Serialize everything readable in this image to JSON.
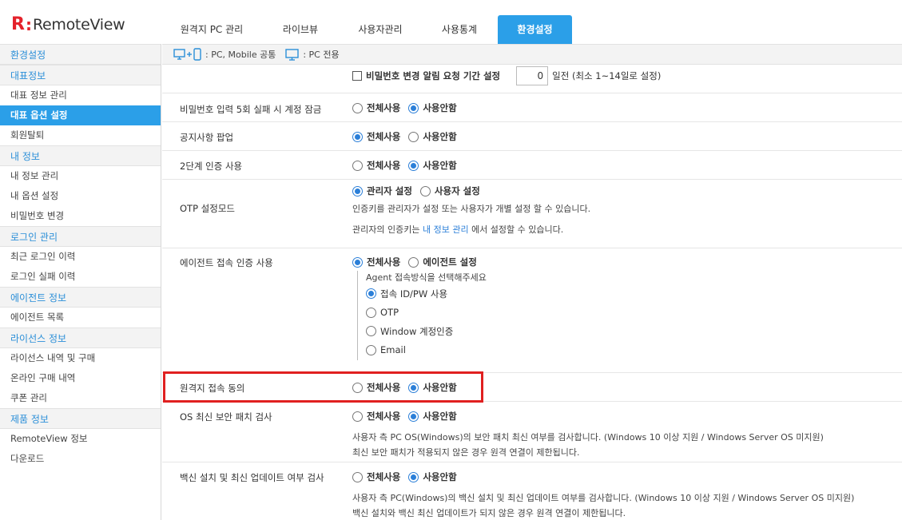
{
  "brand": {
    "mark": "R",
    "colon": ":",
    "name": "RemoteView"
  },
  "nav": [
    {
      "label": "원격지 PC 관리",
      "width": 124
    },
    {
      "label": "라이브뷰",
      "width": 98
    },
    {
      "label": "사용자관리",
      "width": 102
    },
    {
      "label": "사용통계",
      "width": 96
    },
    {
      "label": "환경설정",
      "width": 93
    }
  ],
  "sidebar": {
    "title": "환경설정",
    "sections": [
      {
        "head": "대표정보",
        "items": [
          "대표 정보 관리",
          "대표 옵션 설정",
          "회원탈퇴"
        ]
      },
      {
        "head": "내 정보",
        "items": [
          "내 정보 관리",
          "내 옵션 설정",
          "비밀번호 변경"
        ]
      },
      {
        "head": "로그인 관리",
        "items": [
          "최근 로그인 이력",
          "로그인 실패 이력"
        ]
      },
      {
        "head": "에이전트 정보",
        "items": [
          "에이전트 목록"
        ]
      },
      {
        "head": "라이선스 정보",
        "items": [
          "라이선스 내역 및 구매",
          "온라인 구매 내역",
          "쿠폰 관리"
        ]
      },
      {
        "head": "제품 정보",
        "items": [
          "RemoteView 정보",
          "다운로드"
        ]
      }
    ]
  },
  "legend": {
    "common": ": PC, Mobile 공통",
    "pc": ": PC 전용"
  },
  "settings": {
    "pw_notice": {
      "label": "비밀번호 변경 알림 요청 기간 설정",
      "value": "0",
      "suffix": "일전 (최소 1~14일로 설정)"
    },
    "opt_all": "전체사용",
    "opt_none": "사용안함",
    "lock": {
      "label": "비밀번호 입력 5회 실패 시 계정 잠금"
    },
    "popup": {
      "label": "공지사항 팝업"
    },
    "twofa": {
      "label": "2단계 인증 사용"
    },
    "otp": {
      "label": "OTP 설정모드",
      "opt_admin": "관리자 설정",
      "opt_user": "사용자 설정",
      "desc1": "인증키를 관리자가 설정 또는 사용자가 개별 설정 할 수 있습니다.",
      "desc2_pre": "관리자의 인증키는",
      "desc2_link": "내 정보 관리",
      "desc2_post": "에서 설정할 수 있습니다."
    },
    "agent_auth": {
      "label": "에이전트 접속 인증 사용",
      "opt_agent": "에이전트 설정",
      "sub_title": "Agent 접속방식을 선택해주세요",
      "sub_opts": [
        "접속 ID/PW 사용",
        "OTP",
        "Window 계정인증",
        "Email"
      ]
    },
    "consent": {
      "label": "원격지 접속 동의"
    },
    "os_patch": {
      "label": "OS 최신 보안 패치 검사",
      "desc1": "사용자 측 PC OS(Windows)의 보안 패치 최신 여부를 검사합니다. (Windows 10 이상 지원 / Windows Server OS 미지원)",
      "desc2": "최신 보안 패치가 적용되지 않은 경우 원격 연결이 제한됩니다."
    },
    "vaccine": {
      "label": "백신 설치 및 최신 업데이트 여부 검사",
      "desc1": "사용자 측 PC(Windows)의 백신 설치 및 최신 업데이트 여부를 검사합니다. (Windows 10 이상 지원 / Windows Server OS 미지원)",
      "desc2": "백신 설치와 백신 최신 업데이트가 되지 않은 경우 원격 연결이 제한됩니다."
    }
  },
  "colors": {
    "accent": "#2b9fe8",
    "brand_red": "#e4222b",
    "highlight": "#e02020"
  }
}
